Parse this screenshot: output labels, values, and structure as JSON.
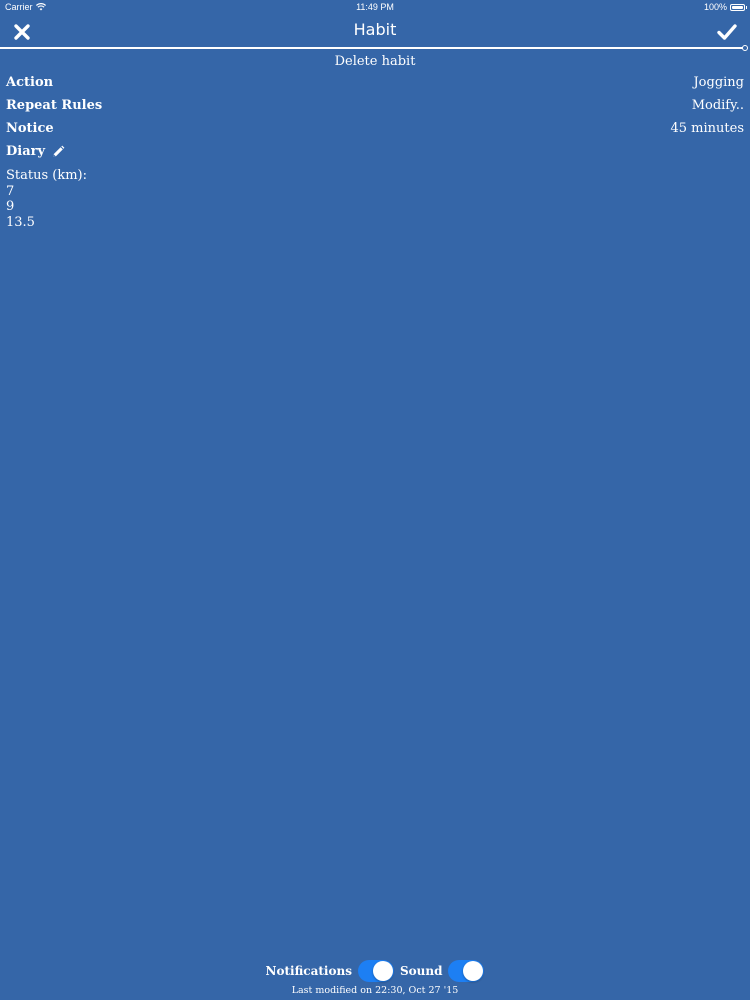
{
  "status_bar": {
    "carrier": "Carrier",
    "time": "11:49 PM",
    "battery": "100%"
  },
  "nav": {
    "title": "Habit",
    "close_icon": "close-icon",
    "confirm_icon": "checkmark-icon"
  },
  "delete_label": "Delete habit",
  "rows": [
    {
      "label": "Action",
      "value": "Jogging"
    },
    {
      "label": "Repeat Rules",
      "value": "Modify.."
    },
    {
      "label": "Notice",
      "value": "45 minutes"
    }
  ],
  "diary": {
    "label": "Diary",
    "icon": "pencil-icon",
    "lines": [
      "Status (km):",
      "7",
      "9",
      "13.5"
    ]
  },
  "footer": {
    "notifications_label": "Notifications",
    "notifications_on": true,
    "sound_label": "Sound",
    "sound_on": true,
    "last_modified": "Last modified on 22:30, Oct 27 '15"
  },
  "colors": {
    "background": "#3566a8",
    "toggle_on": "#1d7ff3",
    "text": "#ffffff"
  }
}
